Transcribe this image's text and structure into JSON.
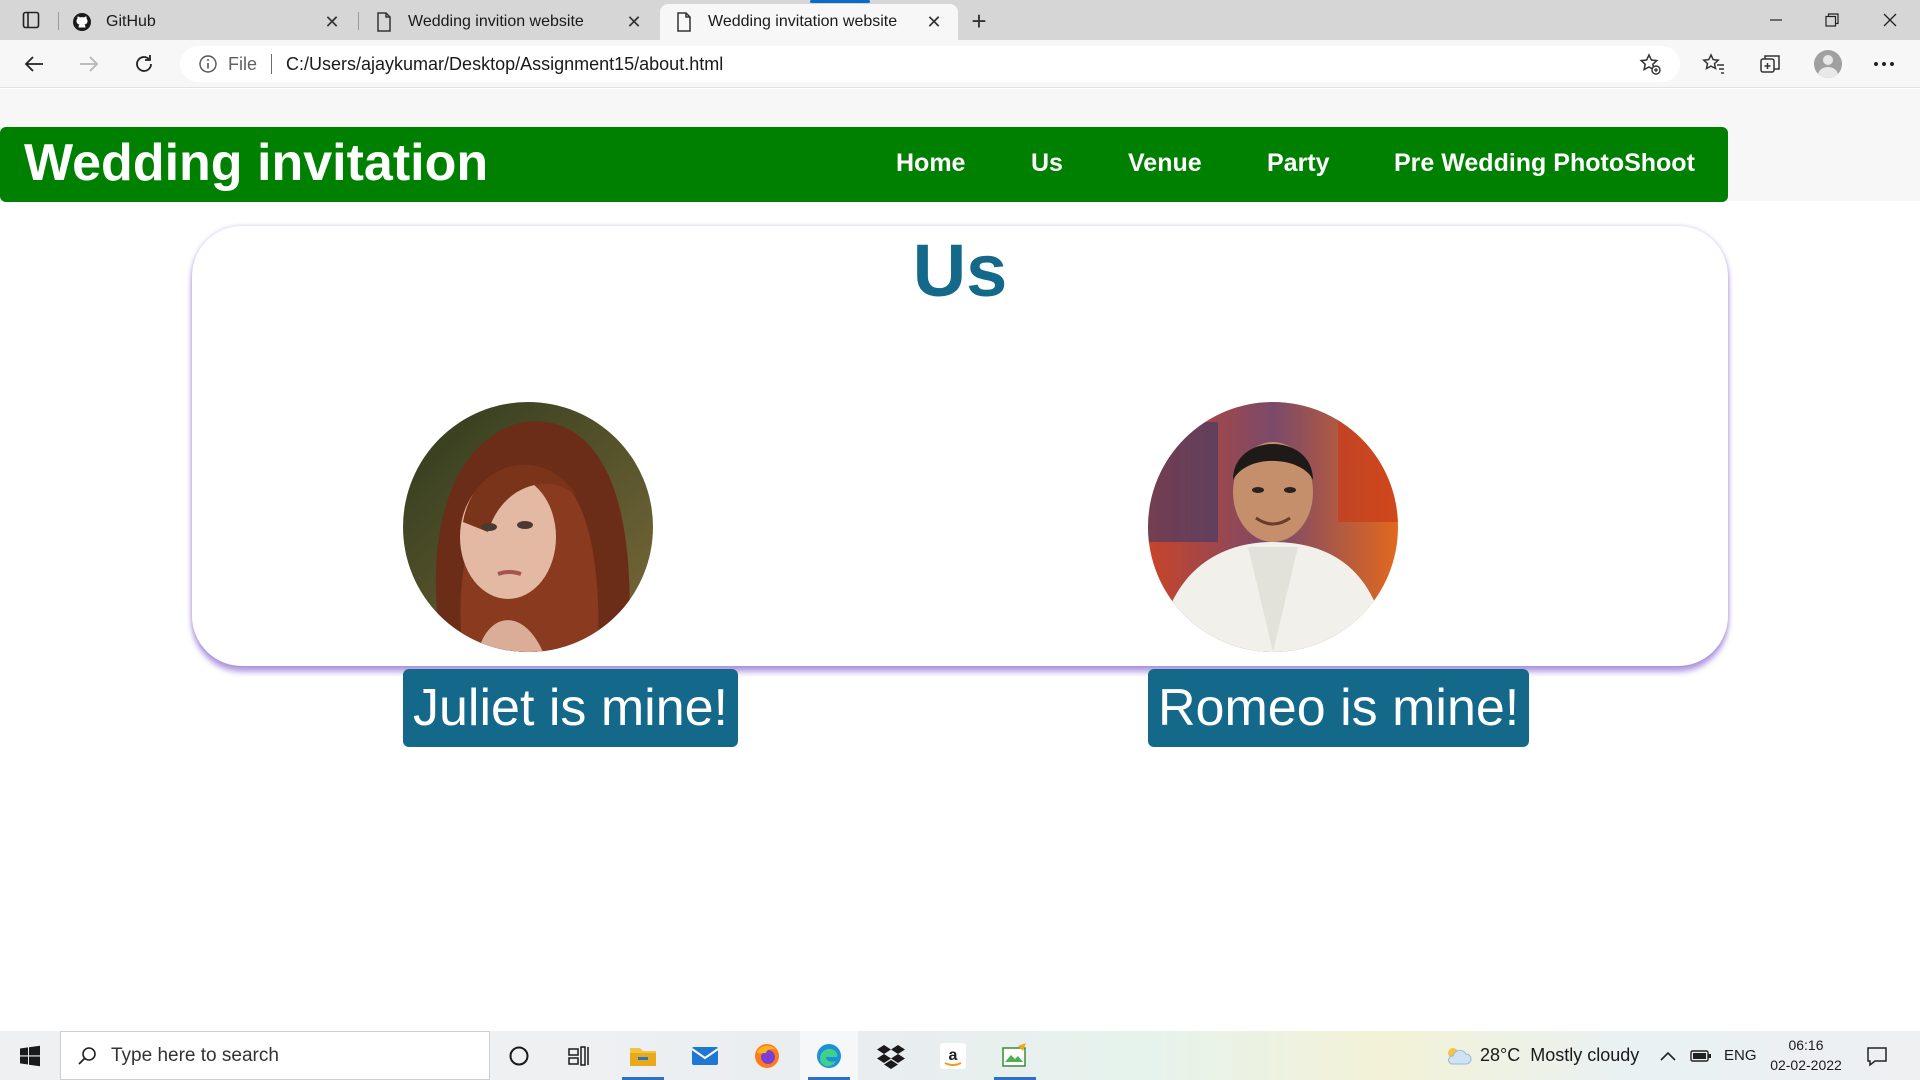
{
  "browser": {
    "tabs": [
      {
        "title": "GitHub",
        "icon": "github-icon"
      },
      {
        "title": "Wedding invition website",
        "icon": "page-icon"
      },
      {
        "title": "Wedding invitation website",
        "icon": "page-icon",
        "active": true
      }
    ],
    "address": {
      "scheme_label": "File",
      "url": "C:/Users/ajaykumar/Desktop/Assignment15/about.html"
    }
  },
  "page": {
    "brand": "Wedding invitation",
    "nav": [
      "Home",
      "Us",
      "Venue",
      "Party",
      "Pre Wedding PhotoShoot"
    ],
    "section_title": "Us",
    "people": [
      {
        "caption": "Juliet is mine!",
        "photo": "woman-portrait"
      },
      {
        "caption": "Romeo is mine!",
        "photo": "man-portrait"
      }
    ],
    "colors": {
      "header_bg": "#008000",
      "accent": "#14698a",
      "card_shadow": "#7850c8"
    }
  },
  "taskbar": {
    "search_placeholder": "Type here to search",
    "weather_temp": "28°C",
    "weather_desc": "Mostly cloudy",
    "language": "ENG",
    "time": "06:16",
    "date": "02-02-2022"
  }
}
